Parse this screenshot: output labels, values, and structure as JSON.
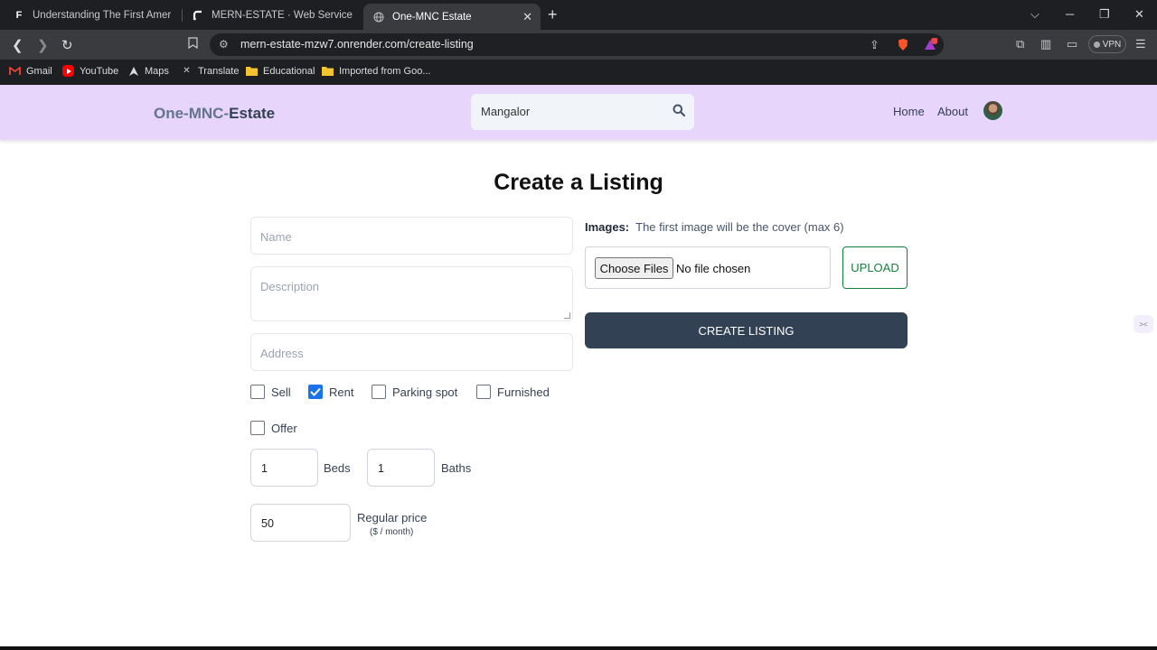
{
  "browser": {
    "tabs": [
      {
        "title": "Understanding The First American Fi",
        "icon": "F"
      },
      {
        "title": "MERN-ESTATE · Web Service · Rend",
        "icon": "render"
      },
      {
        "title": "One-MNC Estate",
        "icon": "globe"
      }
    ],
    "url": "mern-estate-mzw7.onrender.com/create-listing",
    "vpn_label": "VPN",
    "notification_badge": "1",
    "bookmarks": [
      {
        "label": "Gmail",
        "icon": "gmail-icon"
      },
      {
        "label": "YouTube",
        "icon": "youtube-icon"
      },
      {
        "label": "Maps",
        "icon": "maps-icon"
      },
      {
        "label": "Translate",
        "icon": "translate-icon"
      },
      {
        "label": "Educational",
        "icon": "folder-icon"
      },
      {
        "label": "Imported from Goo...",
        "icon": "folder-icon"
      }
    ]
  },
  "header": {
    "logo_part1": "One-MNC-",
    "logo_part2": "Estate",
    "search_value": "Mangalor",
    "nav": [
      "Home",
      "About"
    ]
  },
  "form": {
    "title": "Create a Listing",
    "name_placeholder": "Name",
    "description_placeholder": "Description",
    "address_placeholder": "Address",
    "checkboxes": [
      {
        "label": "Sell",
        "checked": false
      },
      {
        "label": "Rent",
        "checked": true
      },
      {
        "label": "Parking spot",
        "checked": false
      },
      {
        "label": "Furnished",
        "checked": false
      },
      {
        "label": "Offer",
        "checked": false
      }
    ],
    "beds_value": "1",
    "beds_label": "Beds",
    "baths_value": "1",
    "baths_label": "Baths",
    "price_value": "50",
    "price_label": "Regular price",
    "price_sub": "($ / month)",
    "images_label": "Images:",
    "images_hint": "The first image will be the cover (max 6)",
    "choose_files": "Choose Files",
    "no_file": "No file chosen",
    "upload": "UPLOAD",
    "create": "CREATE LISTING"
  },
  "colors": {
    "header_bg": "#e8d5fb",
    "primary": "#334155",
    "upload_green": "#15803d",
    "checkbox_blue": "#1a73e8"
  }
}
